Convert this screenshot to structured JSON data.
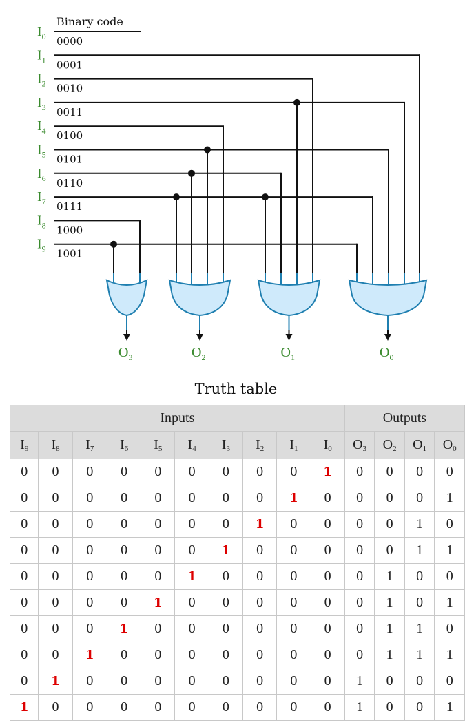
{
  "diagram": {
    "header_label": "Binary code",
    "inputs": [
      {
        "name": "I",
        "sub": "0",
        "code": "0000"
      },
      {
        "name": "I",
        "sub": "1",
        "code": "0001"
      },
      {
        "name": "I",
        "sub": "2",
        "code": "0010"
      },
      {
        "name": "I",
        "sub": "3",
        "code": "0011"
      },
      {
        "name": "I",
        "sub": "4",
        "code": "0100"
      },
      {
        "name": "I",
        "sub": "5",
        "code": "0101"
      },
      {
        "name": "I",
        "sub": "6",
        "code": "0110"
      },
      {
        "name": "I",
        "sub": "7",
        "code": "0111"
      },
      {
        "name": "I",
        "sub": "8",
        "code": "1000"
      },
      {
        "name": "I",
        "sub": "9",
        "code": "1001"
      }
    ],
    "gates": [
      {
        "output": "O",
        "sub": "3",
        "type": "OR",
        "inputs": [
          9,
          8
        ]
      },
      {
        "output": "O",
        "sub": "2",
        "type": "OR",
        "inputs": [
          7,
          6,
          5,
          4
        ]
      },
      {
        "output": "O",
        "sub": "1",
        "type": "OR",
        "inputs": [
          7,
          6,
          3,
          2
        ]
      },
      {
        "output": "O",
        "sub": "0",
        "type": "OR",
        "inputs": [
          9,
          7,
          5,
          3,
          1
        ]
      }
    ],
    "colors": {
      "label_green": "#3a8a2e",
      "wire": "#111111",
      "gate_fill": "#cfeafb",
      "gate_stroke": "#1f7fb0",
      "highlight_red": "#dd0000",
      "table_header_bg": "#dcdcdc"
    }
  },
  "truth_table": {
    "title": "Truth table",
    "group_headers": {
      "inputs": "Inputs",
      "outputs": "Outputs"
    },
    "columns": [
      {
        "name": "I",
        "sub": "9"
      },
      {
        "name": "I",
        "sub": "8"
      },
      {
        "name": "I",
        "sub": "7"
      },
      {
        "name": "I",
        "sub": "6"
      },
      {
        "name": "I",
        "sub": "5"
      },
      {
        "name": "I",
        "sub": "4"
      },
      {
        "name": "I",
        "sub": "3"
      },
      {
        "name": "I",
        "sub": "2"
      },
      {
        "name": "I",
        "sub": "1"
      },
      {
        "name": "I",
        "sub": "0"
      },
      {
        "name": "O",
        "sub": "3"
      },
      {
        "name": "O",
        "sub": "2"
      },
      {
        "name": "O",
        "sub": "1"
      },
      {
        "name": "O",
        "sub": "0"
      }
    ],
    "rows": [
      [
        "0",
        "0",
        "0",
        "0",
        "0",
        "0",
        "0",
        "0",
        "0",
        "1",
        "0",
        "0",
        "0",
        "0"
      ],
      [
        "0",
        "0",
        "0",
        "0",
        "0",
        "0",
        "0",
        "0",
        "1",
        "0",
        "0",
        "0",
        "0",
        "1"
      ],
      [
        "0",
        "0",
        "0",
        "0",
        "0",
        "0",
        "0",
        "1",
        "0",
        "0",
        "0",
        "0",
        "1",
        "0"
      ],
      [
        "0",
        "0",
        "0",
        "0",
        "0",
        "0",
        "1",
        "0",
        "0",
        "0",
        "0",
        "0",
        "1",
        "1"
      ],
      [
        "0",
        "0",
        "0",
        "0",
        "0",
        "1",
        "0",
        "0",
        "0",
        "0",
        "0",
        "1",
        "0",
        "0"
      ],
      [
        "0",
        "0",
        "0",
        "0",
        "1",
        "0",
        "0",
        "0",
        "0",
        "0",
        "0",
        "1",
        "0",
        "1"
      ],
      [
        "0",
        "0",
        "0",
        "1",
        "0",
        "0",
        "0",
        "0",
        "0",
        "0",
        "0",
        "1",
        "1",
        "0"
      ],
      [
        "0",
        "0",
        "1",
        "0",
        "0",
        "0",
        "0",
        "0",
        "0",
        "0",
        "0",
        "1",
        "1",
        "1"
      ],
      [
        "0",
        "1",
        "0",
        "0",
        "0",
        "0",
        "0",
        "0",
        "0",
        "0",
        "1",
        "0",
        "0",
        "0"
      ],
      [
        "1",
        "0",
        "0",
        "0",
        "0",
        "0",
        "0",
        "0",
        "0",
        "0",
        "1",
        "0",
        "0",
        "1"
      ]
    ],
    "highlighted_cells": [
      [
        0,
        9
      ],
      [
        1,
        8
      ],
      [
        2,
        7
      ],
      [
        3,
        6
      ],
      [
        4,
        5
      ],
      [
        5,
        4
      ],
      [
        6,
        3
      ],
      [
        7,
        2
      ],
      [
        8,
        1
      ],
      [
        9,
        0
      ]
    ]
  }
}
